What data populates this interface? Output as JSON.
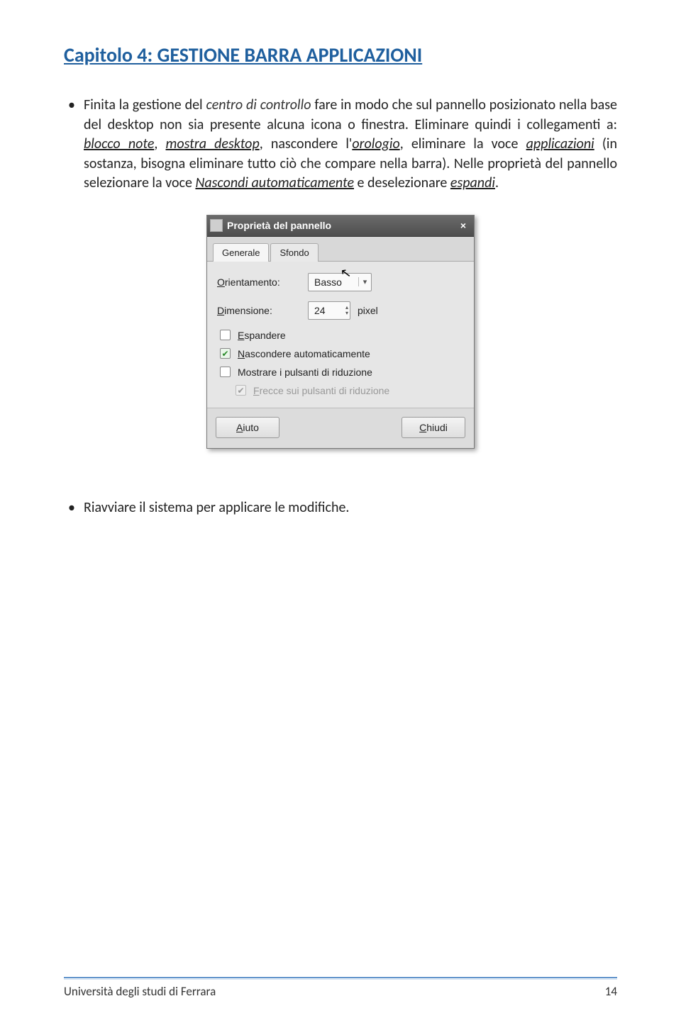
{
  "chapter_title": "Capitolo 4: GESTIONE BARRA APPLICAZIONI",
  "para1": {
    "t0": "Finita la gestione del ",
    "centro": "centro di controllo",
    "t1": " fare in modo che sul pannello posizionato nella base del desktop non sia presente alcuna icona o finestra. Eliminare quindi i collegamenti a: ",
    "blocco": "blocco note",
    "t2": ", ",
    "mostra": "mostra desktop",
    "t3": ", nascondere l'",
    "orologio": "orologio",
    "t4": ", eliminare la voce ",
    "applicazioni": "applicazioni",
    "t5": " (in sostanza, bisogna eliminare tutto ciò che compare nella barra). Nelle proprietà del pannello selezionare la voce ",
    "nascondi": "Nascondi automaticamente",
    "t6": " e deselezionare ",
    "espandi": "espandi",
    "t7": "."
  },
  "dialog": {
    "title": "Proprietà del pannello",
    "close": "×",
    "tab_general": "Generale",
    "tab_background": "Sfondo",
    "orient_label_pre": "O",
    "orient_label_rest": "rientamento:",
    "orient_value": "Basso",
    "size_label_pre": "D",
    "size_label_rest": "imensione:",
    "size_value": "24",
    "size_unit": "pixel",
    "chk_expand_pre": "E",
    "chk_expand_rest": "spandere",
    "chk_autohide_pre": "N",
    "chk_autohide_rest": "ascondere automaticamente",
    "chk_showhide": "Mostrare i pulsanti di riduzione",
    "chk_arrows_pre": "F",
    "chk_arrows_rest": "recce sui pulsanti di riduzione",
    "btn_help_pre": "A",
    "btn_help_rest": "iuto",
    "btn_close_pre": "C",
    "btn_close_rest": "hiudi"
  },
  "para2": "Riavviare il sistema per applicare le modifiche.",
  "footer": {
    "left": "Università degli studi di Ferrara",
    "right": "14"
  }
}
